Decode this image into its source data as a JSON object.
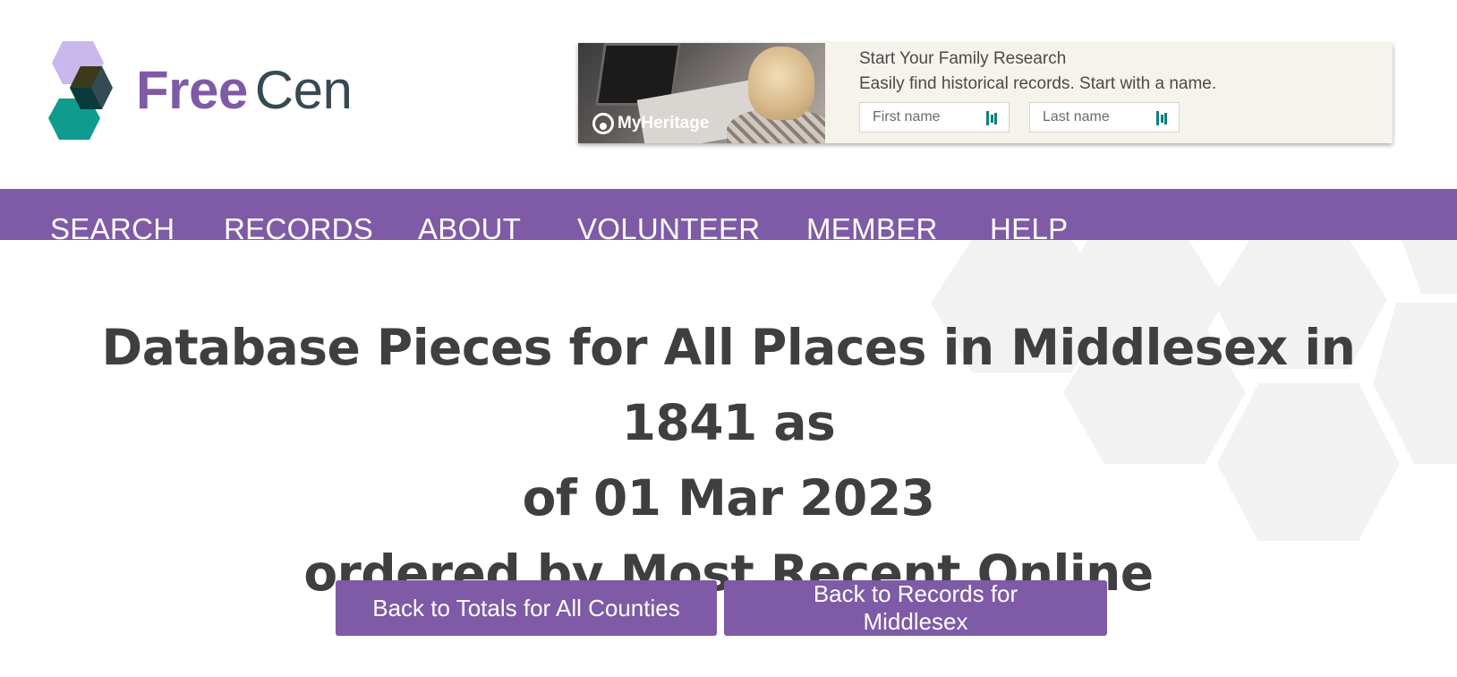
{
  "logo": {
    "free": "Free",
    "cen": "Cen"
  },
  "ad": {
    "brand": "MyHeritage",
    "title": "Start Your Family Research",
    "subtitle": "Easily find historical records. Start with a name.",
    "first_name_placeholder": "First name",
    "last_name_placeholder": "Last name"
  },
  "nav": {
    "items": [
      {
        "label": "SEARCH"
      },
      {
        "label": "RECORDS"
      },
      {
        "label": "ABOUT"
      },
      {
        "label": "VOLUNTEER"
      },
      {
        "label": "MEMBER"
      },
      {
        "label": "HELP"
      }
    ]
  },
  "main": {
    "title_line1": "Database Pieces for All Places in Middlesex in 1841 as",
    "title_line2": "of 01 Mar 2023",
    "title_line3": "ordered by Most Recent Online",
    "buttons": [
      {
        "label": "Back to Totals for All Counties"
      },
      {
        "label": "Back to Records for Middlesex"
      }
    ]
  },
  "colors": {
    "brand_purple": "#7f5aa7",
    "brand_slate": "#364a55",
    "text_dark": "#3f3f3f",
    "teal": "#0f9b8e",
    "lavender": "#c9b8ec"
  }
}
